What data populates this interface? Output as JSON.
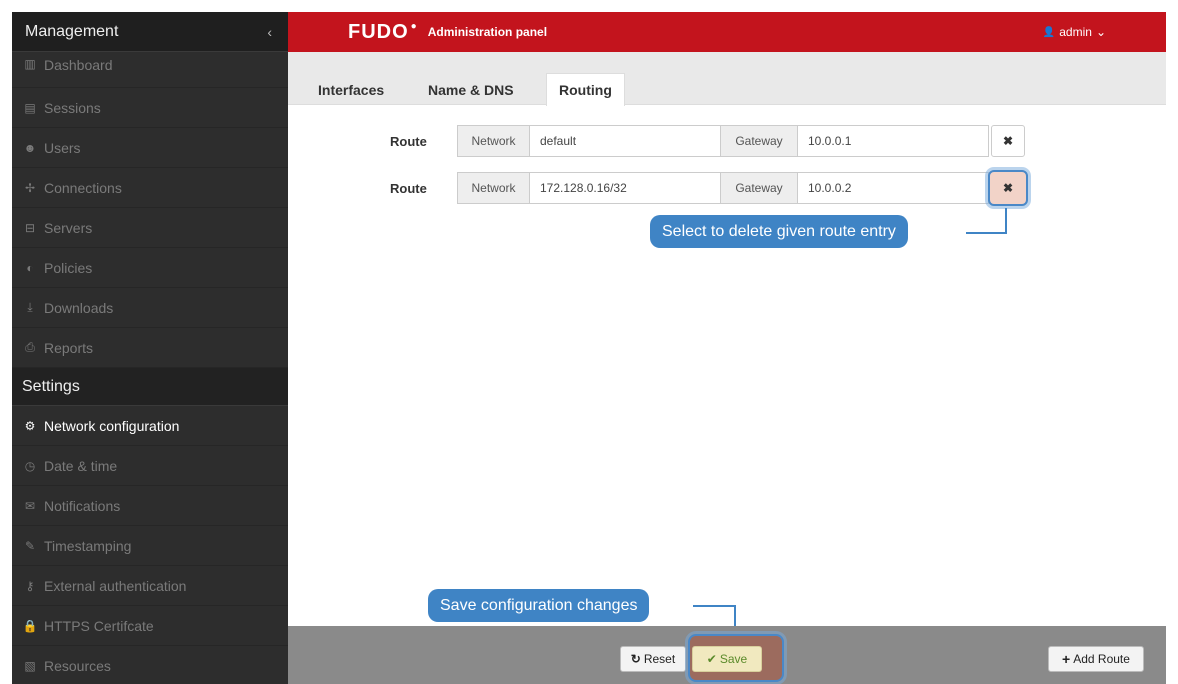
{
  "sidebar": {
    "header": "Management",
    "collapse_icon": "‹",
    "items": [
      {
        "icon": "▥",
        "label": "Dashboard"
      },
      {
        "icon": "▤",
        "label": "Sessions"
      },
      {
        "icon": "☻",
        "label": "Users"
      },
      {
        "icon": "✢",
        "label": "Connections"
      },
      {
        "icon": "⊟",
        "label": "Servers"
      },
      {
        "icon": "◐",
        "label": "Policies"
      },
      {
        "icon": "⤓",
        "label": "Downloads"
      },
      {
        "icon": "⎙",
        "label": "Reports"
      }
    ],
    "settings_header": "Settings",
    "settings_items": [
      {
        "icon": "⚙",
        "label": "Network configuration"
      },
      {
        "icon": "◷",
        "label": "Date & time"
      },
      {
        "icon": "✉",
        "label": "Notifications"
      },
      {
        "icon": "✎",
        "label": "Timestamping"
      },
      {
        "icon": "⚷",
        "label": "External authentication"
      },
      {
        "icon": "🔒",
        "label": "HTTPS Certifcate"
      },
      {
        "icon": "▧",
        "label": "Resources"
      }
    ]
  },
  "topbar": {
    "logo": "FUDO",
    "title": "Administration panel",
    "user_icon": "👤",
    "user": "admin",
    "user_caret": "⌄"
  },
  "tabs": [
    "Interfaces",
    "Name & DNS",
    "Routing"
  ],
  "routes": [
    {
      "label": "Route",
      "network_label": "Network",
      "network": "default",
      "gateway_label": "Gateway",
      "gateway": "10.0.0.1",
      "delete": "✖"
    },
    {
      "label": "Route",
      "network_label": "Network",
      "network": "172.128.0.16/32",
      "gateway_label": "Gateway",
      "gateway": "10.0.0.2",
      "delete": "✖"
    }
  ],
  "callouts": {
    "delete": "Select to delete given route entry",
    "save": "Save configuration changes"
  },
  "footer": {
    "reset_icon": "↻",
    "reset": "Reset",
    "save_icon": "✔",
    "save": "Save",
    "add_icon": "+",
    "add": "Add Route"
  }
}
